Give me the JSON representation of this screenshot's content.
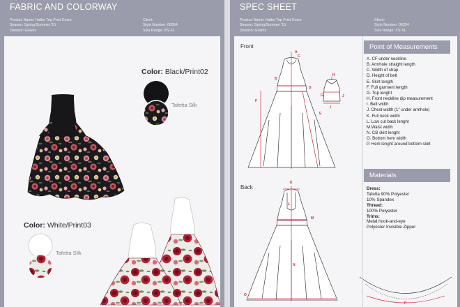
{
  "fabric": {
    "title": "FABRIC AND COLORWAY",
    "info": {
      "product": "Product Name: Halter Top Print Gown",
      "season": "Season: Spring/Summer '15",
      "division": "Division: Gowns",
      "client": "Client:",
      "style": "Style Number: 06354",
      "size": "Size Range: XS-XL"
    },
    "colorways": [
      {
        "label": "Color:",
        "value": "Black/Print02",
        "fabric": "Tafetta Silk"
      },
      {
        "label": "Color:",
        "value": "White/Print03",
        "fabric": "Tafetta Silk"
      }
    ]
  },
  "spec": {
    "title": "SPEC SHEET",
    "info": {
      "product": "Product Name: Halter Top Print Gown",
      "season": "Season: Spring/Summer '15",
      "division": "Division: Gowns",
      "client": "Client:",
      "style": "Style Number: 06354",
      "size": "Size Range: XS-XL"
    },
    "front_label": "Front",
    "back_label": "Back",
    "pom_title": "Point of Measurements",
    "pom": [
      "A. CF under neckline",
      "B. Armhole straight length",
      "C. Width of strap",
      "D. Height of belt",
      "E. Skirt length",
      "F. Full garment length",
      "G. Top lenght",
      "H. Front neckline dip measurement",
      "I. Belt width",
      "J. Chest width (1\" under armhole)",
      "K. Full neck width",
      "L. Low cut back lenght",
      "M.Waist width",
      "N. CB skirt lenght",
      "O. Bottom hem width",
      "P. Hem lenght around bottom skirt"
    ],
    "materials_title": "Materials",
    "materials": {
      "dress_label": "Dress:",
      "dress": [
        "Tafetta 90% Polyester",
        "10% Spandex"
      ],
      "thread_label": "Thread:",
      "thread": [
        "100% Polyester"
      ],
      "trims_label": "Trims:",
      "trims": [
        "Metal hook-and-eye",
        "Polyester Invisible Zipper"
      ]
    },
    "callouts": [
      "A",
      "B",
      "C",
      "D",
      "E",
      "F",
      "G",
      "H",
      "I",
      "J",
      "K",
      "L",
      "M",
      "N",
      "O",
      "P"
    ]
  },
  "colors": {
    "panel": "#9a9cab",
    "sheet": "#f5f5f7",
    "dark_bodice": "#17171a",
    "dark_print": "#1b1a1e",
    "rose_red": "#a3182f",
    "measure_red": "#d0303c"
  }
}
